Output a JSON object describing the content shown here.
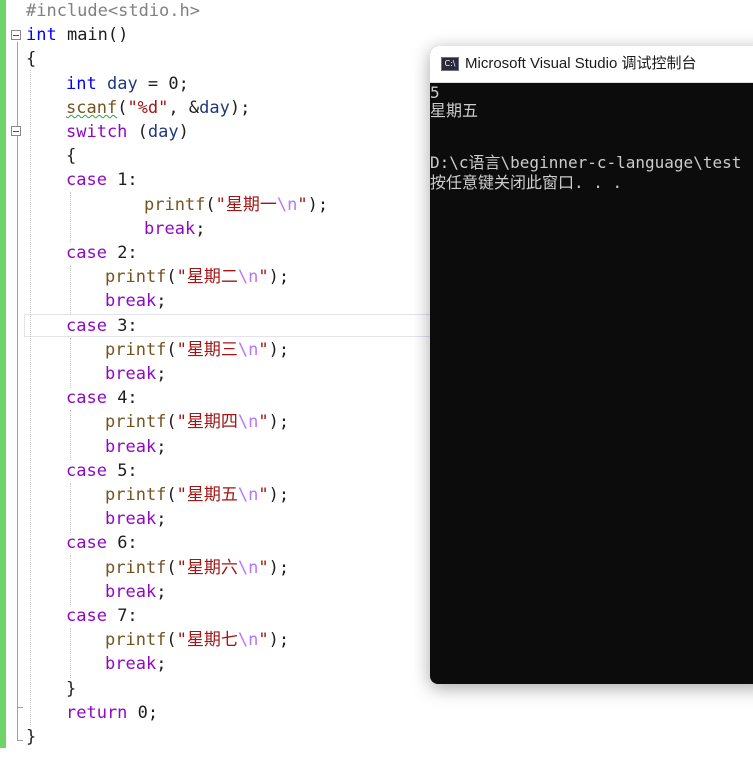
{
  "editor": {
    "lines": [
      {
        "indent": 0,
        "parts": [
          {
            "t": "#include<stdio.h>",
            "c": "pre"
          }
        ]
      },
      {
        "indent": 0,
        "parts": [
          {
            "t": "int",
            "c": "kw"
          },
          {
            "t": " main()",
            "c": "plain"
          }
        ]
      },
      {
        "indent": 0,
        "parts": [
          {
            "t": "{",
            "c": "plain"
          }
        ]
      },
      {
        "indent": 1,
        "parts": [
          {
            "t": "int",
            "c": "kw"
          },
          {
            "t": " ",
            "c": "plain"
          },
          {
            "t": "day",
            "c": "var"
          },
          {
            "t": " = 0;",
            "c": "plain"
          }
        ]
      },
      {
        "indent": 1,
        "parts": [
          {
            "t": "scanf",
            "c": "fn squiggle"
          },
          {
            "t": "(",
            "c": "plain"
          },
          {
            "t": "\"%d\"",
            "c": "str"
          },
          {
            "t": ", &",
            "c": "plain"
          },
          {
            "t": "day",
            "c": "var"
          },
          {
            "t": ");",
            "c": "plain"
          }
        ]
      },
      {
        "indent": 1,
        "parts": [
          {
            "t": "switch",
            "c": "ctl"
          },
          {
            "t": " (",
            "c": "plain"
          },
          {
            "t": "day",
            "c": "var"
          },
          {
            "t": ")",
            "c": "plain"
          }
        ]
      },
      {
        "indent": 1,
        "parts": [
          {
            "t": "{",
            "c": "plain"
          }
        ]
      },
      {
        "indent": 1,
        "parts": [
          {
            "t": "case",
            "c": "ctl"
          },
          {
            "t": " 1:",
            "c": "plain"
          }
        ]
      },
      {
        "indent": 3,
        "parts": [
          {
            "t": "printf",
            "c": "fn"
          },
          {
            "t": "(",
            "c": "plain"
          },
          {
            "t": "\"星期一",
            "c": "str"
          },
          {
            "t": "\\n",
            "c": "esc"
          },
          {
            "t": "\"",
            "c": "str"
          },
          {
            "t": ");",
            "c": "plain"
          }
        ]
      },
      {
        "indent": 3,
        "parts": [
          {
            "t": "break",
            "c": "ctl"
          },
          {
            "t": ";",
            "c": "plain"
          }
        ]
      },
      {
        "indent": 1,
        "parts": [
          {
            "t": "case",
            "c": "ctl"
          },
          {
            "t": " 2:",
            "c": "plain"
          }
        ]
      },
      {
        "indent": 2,
        "parts": [
          {
            "t": "printf",
            "c": "fn"
          },
          {
            "t": "(",
            "c": "plain"
          },
          {
            "t": "\"星期二",
            "c": "str"
          },
          {
            "t": "\\n",
            "c": "esc"
          },
          {
            "t": "\"",
            "c": "str"
          },
          {
            "t": ");",
            "c": "plain"
          }
        ]
      },
      {
        "indent": 2,
        "parts": [
          {
            "t": "break",
            "c": "ctl"
          },
          {
            "t": ";",
            "c": "plain"
          }
        ]
      },
      {
        "indent": 1,
        "parts": [
          {
            "t": "case",
            "c": "ctl"
          },
          {
            "t": " 3:",
            "c": "plain"
          }
        ]
      },
      {
        "indent": 2,
        "parts": [
          {
            "t": "printf",
            "c": "fn"
          },
          {
            "t": "(",
            "c": "plain"
          },
          {
            "t": "\"星期三",
            "c": "str"
          },
          {
            "t": "\\n",
            "c": "esc"
          },
          {
            "t": "\"",
            "c": "str"
          },
          {
            "t": ");",
            "c": "plain"
          }
        ]
      },
      {
        "indent": 2,
        "parts": [
          {
            "t": "break",
            "c": "ctl"
          },
          {
            "t": ";",
            "c": "plain"
          }
        ]
      },
      {
        "indent": 1,
        "parts": [
          {
            "t": "case",
            "c": "ctl"
          },
          {
            "t": " 4:",
            "c": "plain"
          }
        ]
      },
      {
        "indent": 2,
        "parts": [
          {
            "t": "printf",
            "c": "fn"
          },
          {
            "t": "(",
            "c": "plain"
          },
          {
            "t": "\"星期四",
            "c": "str"
          },
          {
            "t": "\\n",
            "c": "esc"
          },
          {
            "t": "\"",
            "c": "str"
          },
          {
            "t": ");",
            "c": "plain"
          }
        ]
      },
      {
        "indent": 2,
        "parts": [
          {
            "t": "break",
            "c": "ctl"
          },
          {
            "t": ";",
            "c": "plain"
          }
        ]
      },
      {
        "indent": 1,
        "parts": [
          {
            "t": "case",
            "c": "ctl"
          },
          {
            "t": " 5:",
            "c": "plain"
          }
        ]
      },
      {
        "indent": 2,
        "parts": [
          {
            "t": "printf",
            "c": "fn"
          },
          {
            "t": "(",
            "c": "plain"
          },
          {
            "t": "\"星期五",
            "c": "str"
          },
          {
            "t": "\\n",
            "c": "esc"
          },
          {
            "t": "\"",
            "c": "str"
          },
          {
            "t": ");",
            "c": "plain"
          }
        ]
      },
      {
        "indent": 2,
        "parts": [
          {
            "t": "break",
            "c": "ctl"
          },
          {
            "t": ";",
            "c": "plain"
          }
        ]
      },
      {
        "indent": 1,
        "parts": [
          {
            "t": "case",
            "c": "ctl"
          },
          {
            "t": " 6:",
            "c": "plain"
          }
        ]
      },
      {
        "indent": 2,
        "parts": [
          {
            "t": "printf",
            "c": "fn"
          },
          {
            "t": "(",
            "c": "plain"
          },
          {
            "t": "\"星期六",
            "c": "str"
          },
          {
            "t": "\\n",
            "c": "esc"
          },
          {
            "t": "\"",
            "c": "str"
          },
          {
            "t": ");",
            "c": "plain"
          }
        ]
      },
      {
        "indent": 2,
        "parts": [
          {
            "t": "break",
            "c": "ctl"
          },
          {
            "t": ";",
            "c": "plain"
          }
        ]
      },
      {
        "indent": 1,
        "parts": [
          {
            "t": "case",
            "c": "ctl"
          },
          {
            "t": " 7:",
            "c": "plain"
          }
        ]
      },
      {
        "indent": 2,
        "parts": [
          {
            "t": "printf",
            "c": "fn"
          },
          {
            "t": "(",
            "c": "plain"
          },
          {
            "t": "\"星期七",
            "c": "str"
          },
          {
            "t": "\\n",
            "c": "esc"
          },
          {
            "t": "\"",
            "c": "str"
          },
          {
            "t": ");",
            "c": "plain"
          }
        ]
      },
      {
        "indent": 2,
        "parts": [
          {
            "t": "break",
            "c": "ctl"
          },
          {
            "t": ";",
            "c": "plain"
          }
        ]
      },
      {
        "indent": 1,
        "parts": [
          {
            "t": "}",
            "c": "plain"
          }
        ]
      },
      {
        "indent": 1,
        "parts": [
          {
            "t": "return",
            "c": "ctl"
          },
          {
            "t": " 0;",
            "c": "plain"
          }
        ]
      },
      {
        "indent": 0,
        "parts": [
          {
            "t": "}",
            "c": "plain"
          }
        ]
      }
    ]
  },
  "console": {
    "title": "Microsoft Visual Studio 调试控制台",
    "icon": "console-app-icon",
    "icon_text": "C:\\",
    "lines": [
      "5",
      "星期五",
      "",
      "D:\\c语言\\beginner-c-language\\test",
      "按任意键关闭此窗口. . ."
    ]
  },
  "colors": {
    "keyword": "#0000ff",
    "control": "#8f08c4",
    "string": "#a31515",
    "escape": "#b776fb",
    "function": "#74531f",
    "variable": "#1f377f",
    "preprocessor": "#808080",
    "change_bar": "#6fd36a",
    "console_bg": "#0c0c0c",
    "console_text": "#cccccc"
  }
}
